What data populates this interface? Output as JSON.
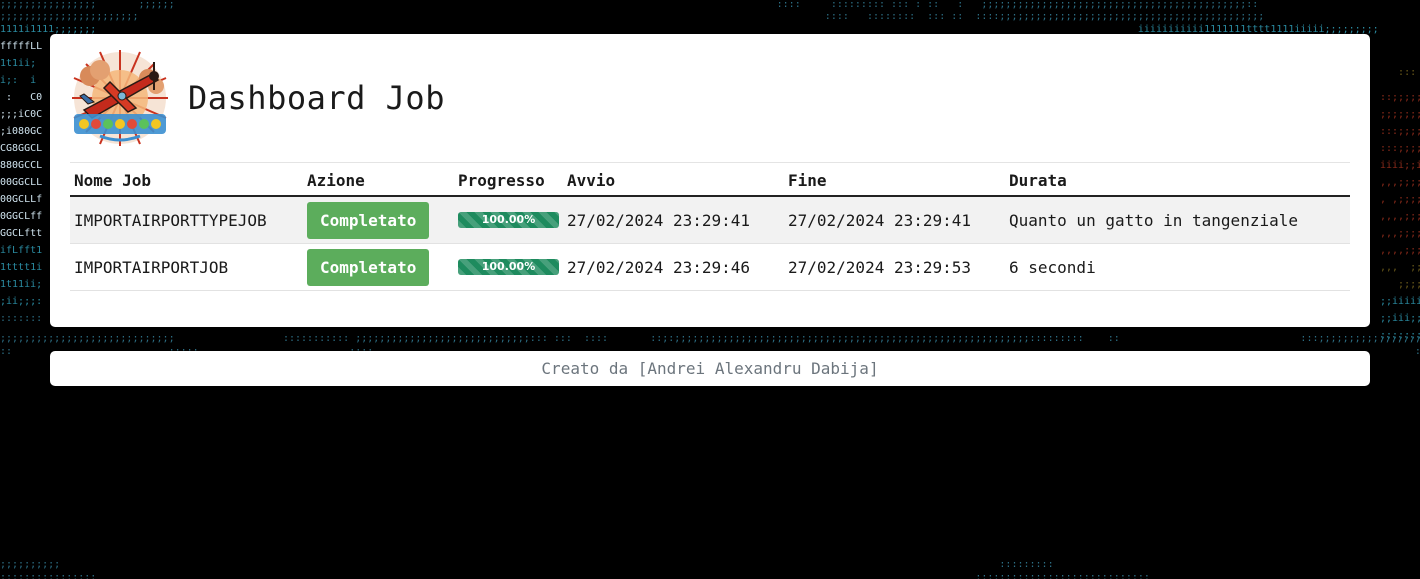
{
  "header": {
    "title": "Dashboard Job",
    "logo_icon": "airplane-logo-icon"
  },
  "table": {
    "columns": [
      "Nome Job",
      "Azione",
      "Progresso",
      "Avvio",
      "Fine",
      "Durata"
    ],
    "rows": [
      {
        "name": "IMPORTAIRPORTTYPEJOB",
        "action": "Completato",
        "progress": 1.0,
        "progress_label": "100.00%",
        "start": "27/02/2024 23:29:41",
        "end": "27/02/2024 23:29:41",
        "duration": "Quanto un gatto in tangenziale"
      },
      {
        "name": "IMPORTAIRPORTJOB",
        "action": "Completato",
        "progress": 1.0,
        "progress_label": "100.00%",
        "start": "27/02/2024 23:29:46",
        "end": "27/02/2024 23:29:53",
        "duration": "6 secondi"
      }
    ]
  },
  "footer": {
    "text": "Creato da [Andrei Alexandru Dabija]"
  },
  "colors": {
    "button": "#5cad5c",
    "progress": "#1e8b5e",
    "background": "#000000"
  }
}
